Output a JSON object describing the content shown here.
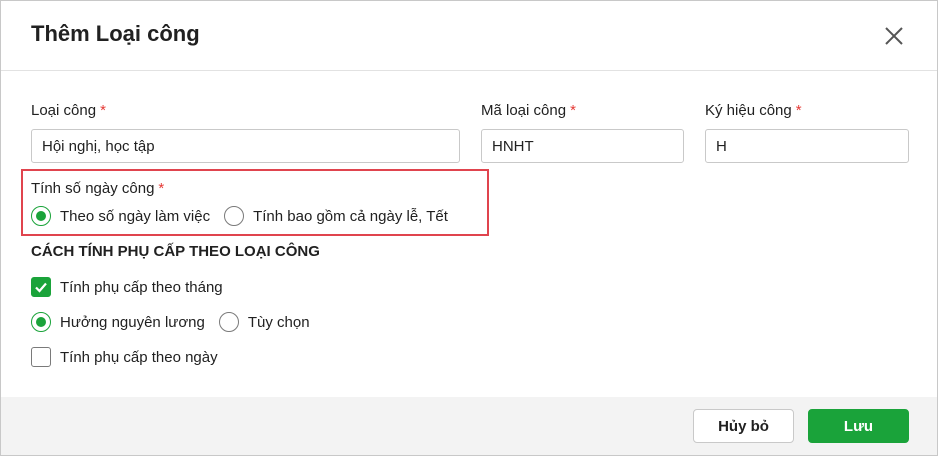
{
  "dialog": {
    "title": "Thêm Loại công",
    "close_icon": "close-icon"
  },
  "fields": {
    "loai_cong": {
      "label": "Loại công",
      "required_mark": "*",
      "value": "Hội nghị, học tập"
    },
    "ma_loai_cong": {
      "label": "Mã loại công",
      "required_mark": "*",
      "value": "HNHT"
    },
    "ky_hieu_cong": {
      "label": "Ký hiệu công",
      "required_mark": "*",
      "value": "H"
    }
  },
  "tinh_so_ngay_cong": {
    "label": "Tính số ngày công",
    "required_mark": "*",
    "options": [
      {
        "label": "Theo số ngày làm việc",
        "selected": true
      },
      {
        "label": "Tính bao gồm cả ngày lễ, Tết",
        "selected": false
      }
    ]
  },
  "phu_cap": {
    "section_title": "CÁCH TÍNH PHỤ CẤP THEO LOẠI CÔNG",
    "theo_thang": {
      "label": "Tính phụ cấp theo tháng",
      "checked": true
    },
    "options": [
      {
        "label": "Hưởng nguyên lương",
        "selected": true
      },
      {
        "label": "Tùy chọn",
        "selected": false
      }
    ],
    "theo_ngay": {
      "label": "Tính phụ cấp theo ngày",
      "checked": false
    }
  },
  "footer": {
    "cancel_label": "Hủy bỏ",
    "save_label": "Lưu"
  },
  "colors": {
    "accent": "#1aa33a",
    "required": "#e53935",
    "highlight_border": "#e0444e"
  }
}
